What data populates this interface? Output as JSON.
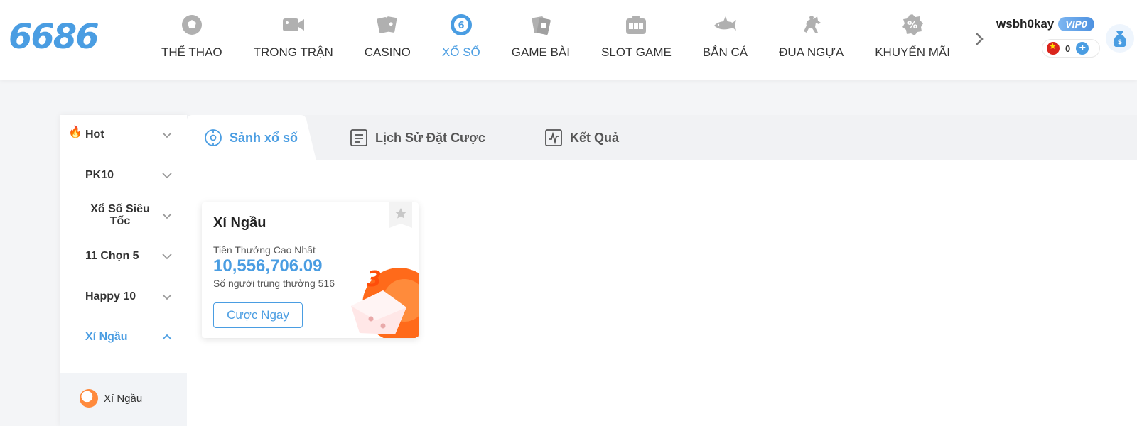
{
  "header": {
    "logo": "6686",
    "nav": [
      {
        "label": "THỂ THAO",
        "icon": "soccer-ball-icon"
      },
      {
        "label": "TRONG TRẬN",
        "icon": "video-camera-icon"
      },
      {
        "label": "CASINO",
        "icon": "playing-cards-icon"
      },
      {
        "label": "XỔ SỐ",
        "icon": "lottery-ball-icon",
        "active": true
      },
      {
        "label": "GAME BÀI",
        "icon": "card-game-icon"
      },
      {
        "label": "SLOT GAME",
        "icon": "slot-machine-icon"
      },
      {
        "label": "BẮN CÁ",
        "icon": "shark-icon"
      },
      {
        "label": "ĐUA NGỰA",
        "icon": "horse-racing-icon"
      },
      {
        "label": "KHUYẾN MÃI",
        "icon": "percent-badge-icon"
      }
    ],
    "user": {
      "username": "wsbh0kay",
      "vip": "VIP0",
      "balance": "0"
    }
  },
  "sidebar": {
    "items": [
      {
        "label": "Hot"
      },
      {
        "label": "PK10"
      },
      {
        "label": "Xổ Số Siêu Tốc"
      },
      {
        "label": "11 Chọn 5"
      },
      {
        "label": "Happy 10"
      },
      {
        "label": "Xí Ngầu",
        "active": true
      }
    ],
    "submenu": [
      {
        "label": "Xí Ngầu"
      }
    ]
  },
  "tabs": [
    {
      "label": "Sảnh xổ số",
      "icon": "target-icon",
      "active": true
    },
    {
      "label": "Lịch Sử Đặt Cược",
      "icon": "document-list-icon"
    },
    {
      "label": "Kết Quả",
      "icon": "chart-line-icon"
    }
  ],
  "game_card": {
    "title": "Xí Ngầu",
    "prize_label": "Tiền Thưởng Cao Nhất",
    "prize_value": "10,556,706.09",
    "winners": "Số người trúng thưởng 516",
    "button": "Cược Ngay"
  },
  "colors": {
    "accent": "#4a9de2",
    "dice_orange": "#ff6a1a"
  }
}
